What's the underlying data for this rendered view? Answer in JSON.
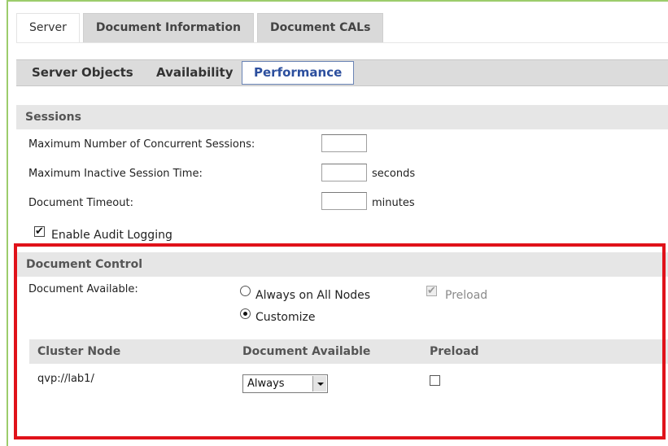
{
  "top_tabs": [
    "Server",
    "Document Information",
    "Document CALs"
  ],
  "sub_tabs": [
    "Server Objects",
    "Availability",
    "Performance"
  ],
  "sessions": {
    "title": "Sessions",
    "max_concurrent_label": "Maximum Number of Concurrent Sessions:",
    "max_concurrent_value": "",
    "max_inactive_label": "Maximum Inactive Session Time:",
    "max_inactive_value": "",
    "max_inactive_unit": "seconds",
    "doc_timeout_label": "Document Timeout:",
    "doc_timeout_value": "",
    "doc_timeout_unit": "minutes",
    "audit_label": "Enable Audit Logging",
    "audit_checked": true
  },
  "doc_control": {
    "title": "Document Control",
    "available_label": "Document Available:",
    "option_all_nodes": "Always on All Nodes",
    "option_customize": "Customize",
    "selected_option": "Customize",
    "preload_label": "Preload",
    "preload_checked": true,
    "preload_disabled": true
  },
  "cluster_table": {
    "headers": [
      "Cluster Node",
      "Document Available",
      "Preload"
    ],
    "rows": [
      {
        "node": "qvp://lab1/",
        "available": "Always",
        "preload": false
      }
    ]
  },
  "colors": {
    "highlight_border": "#e0121a",
    "active_tab_text": "#2c4f9e",
    "frame_accent": "#9ccc6b"
  }
}
